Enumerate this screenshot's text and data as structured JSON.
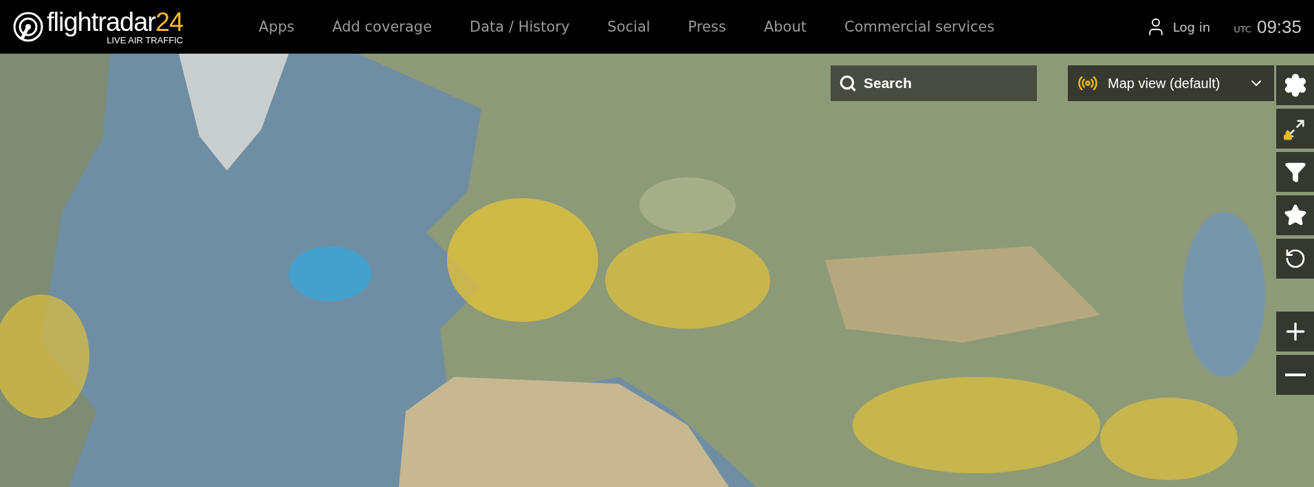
{
  "header": {
    "logo": {
      "name": "flightradar",
      "number": "24",
      "tagline": "LIVE AIR TRAFFIC"
    },
    "nav": [
      {
        "label": "Apps"
      },
      {
        "label": "Add coverage"
      },
      {
        "label": "Data / History"
      },
      {
        "label": "Social"
      },
      {
        "label": "Press"
      },
      {
        "label": "About"
      },
      {
        "label": "Commercial services"
      }
    ],
    "login": "Log in",
    "clock": {
      "zone": "UTC",
      "time": "09:35"
    }
  },
  "map": {
    "kind": "picture",
    "search": {
      "placeholder": "Search"
    },
    "view_select": {
      "value": "Map view (default)"
    },
    "tools": [
      {
        "kind": "settings"
      },
      {
        "kind": "fullscreen"
      },
      {
        "kind": "filter"
      },
      {
        "kind": "favorites"
      },
      {
        "kind": "playback"
      }
    ],
    "zoom": [
      {
        "kind": "in"
      },
      {
        "kind": "out"
      }
    ]
  }
}
